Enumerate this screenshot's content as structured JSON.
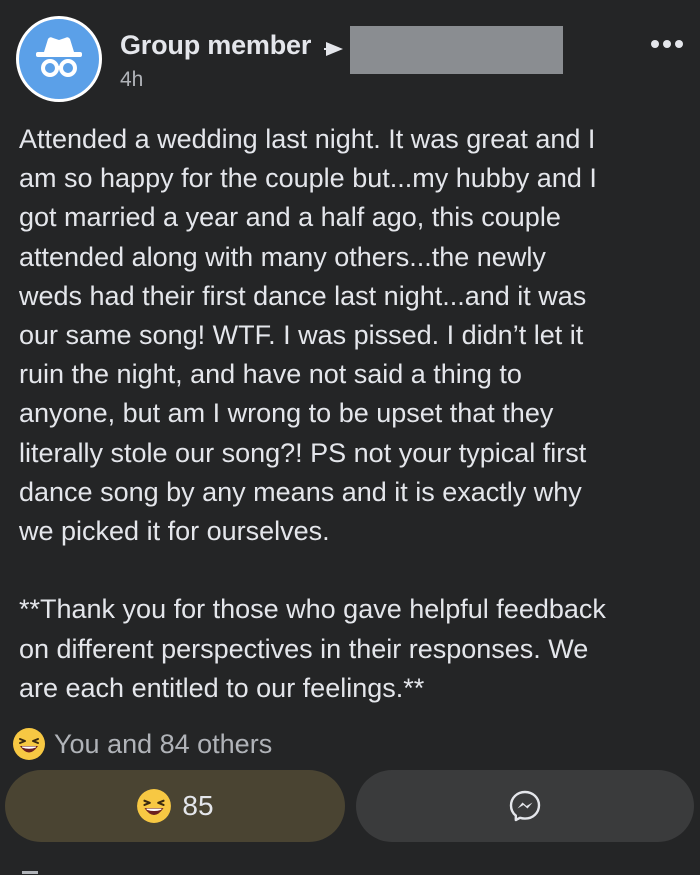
{
  "post": {
    "author": "Group member",
    "timestamp": "4h",
    "body_lines": [
      "Attended a wedding last night. It was great and I",
      "am so happy for the couple but...my hubby and I",
      "got married a year and a half ago, this couple",
      "attended along with many others...the newly",
      "weds had their first dance last night...and it was",
      "our same song! WTF. I was pissed. I didn’t let it",
      "ruin the night, and have not said a thing to",
      "anyone, but am I wrong to be upset that they",
      "literally stole our song?! PS not your typical first",
      "dance song by any means and it is exactly why",
      "we picked it for ourselves."
    ],
    "edit_lines": [
      "**Thank you for those who gave helpful feedback",
      "on different perspectives in their responses. We",
      "are each entitled to our feelings.**"
    ]
  },
  "reactions": {
    "summary": "You and 84 others",
    "icon": "laughing-emoji",
    "count": "85"
  },
  "actions": {
    "message_icon": "messenger-icon"
  },
  "colors": {
    "background": "#242526",
    "text": "#e4e6eb",
    "secondary_text": "#b0b3b8",
    "react_button": "#4a4432",
    "message_button": "#3a3b3c",
    "avatar": "#5ba0e8",
    "redaction": "#8a8d91"
  }
}
